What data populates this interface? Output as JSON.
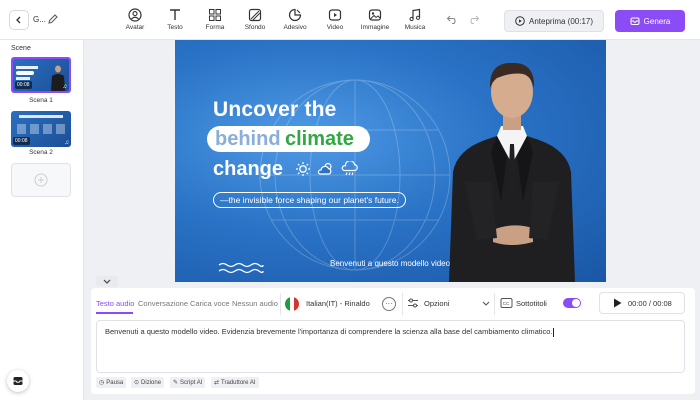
{
  "header": {
    "project_name": "G...",
    "tools": [
      {
        "label": "Avatar",
        "icon": "avatar-icon"
      },
      {
        "label": "Testo",
        "icon": "text-icon"
      },
      {
        "label": "Forma",
        "icon": "shapes-icon"
      },
      {
        "label": "Sfondo",
        "icon": "background-icon"
      },
      {
        "label": "Adesivo",
        "icon": "sticker-icon"
      },
      {
        "label": "Video",
        "icon": "video-icon"
      },
      {
        "label": "Immagine",
        "icon": "image-icon"
      },
      {
        "label": "Musica",
        "icon": "music-icon"
      }
    ],
    "preview_label": "Anteprima (00:17)",
    "generate_label": "Genera"
  },
  "sidebar": {
    "title": "Scene",
    "scenes": [
      {
        "label": "Scena 1",
        "duration": "00:08",
        "selected": true
      },
      {
        "label": "Scena 2",
        "duration": "00:08",
        "selected": false
      }
    ]
  },
  "canvas": {
    "headline_1": "Uncover the",
    "headline_2a": "behind",
    "headline_2b": "climate",
    "headline_3": "change",
    "subtitle": "—the invisible force shaping our planet's future.",
    "caption": "Benvenuti a questo modello video."
  },
  "editor": {
    "tabs": [
      {
        "label": "Testo audio",
        "active": true
      },
      {
        "label": "Conversazione",
        "active": false
      },
      {
        "label": "Carica voce",
        "active": false
      },
      {
        "label": "Nessun audio",
        "active": false
      }
    ],
    "voice": "Italian(IT) - Rinaldo",
    "more_glyph": "···",
    "options_label": "Opzioni",
    "subtitles_label": "Sottotitoli",
    "subtitles_on": true,
    "time": "00:00 / 00:08",
    "script_text": "Benvenuti a questo modello video. Evidenzia brevemente l'importanza di comprendere la scienza alla base del cambiamento climatico.",
    "chips": [
      {
        "label": "Pausa",
        "icon": "clock-icon"
      },
      {
        "label": "Dizione",
        "icon": "dictation-icon"
      },
      {
        "label": "Script AI",
        "icon": "script-ai-icon"
      },
      {
        "label": "Traduttore AI",
        "icon": "translator-icon"
      }
    ]
  },
  "colors": {
    "accent": "#8c4cf5",
    "canvas_bg": "#2a73c6",
    "highlight_green": "#31a842"
  }
}
